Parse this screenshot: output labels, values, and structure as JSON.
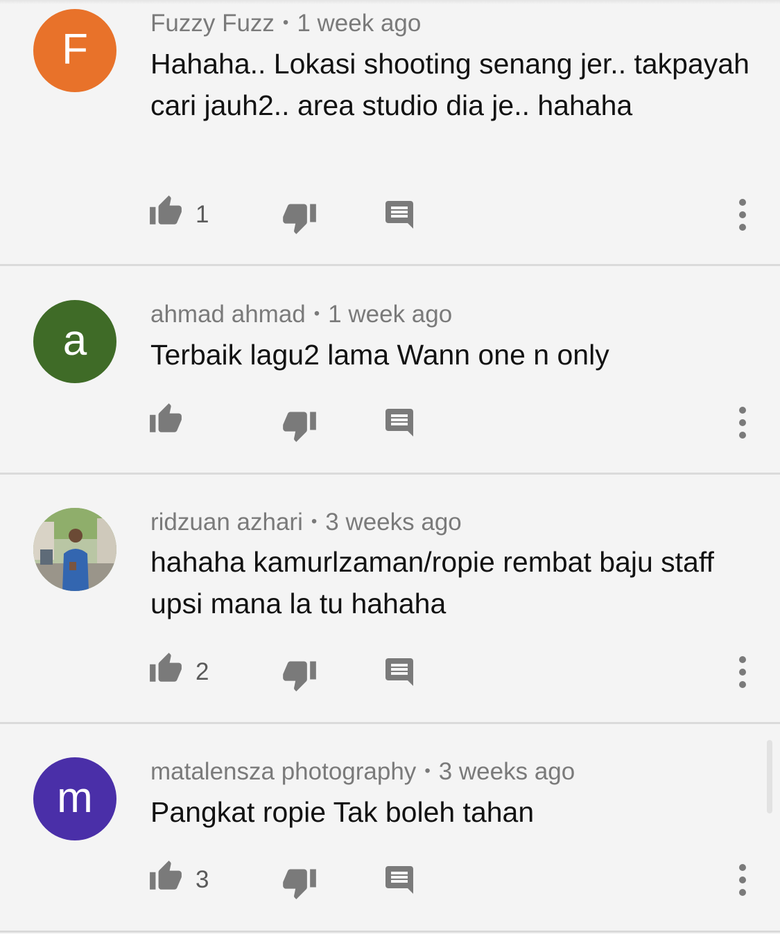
{
  "comments": [
    {
      "author": "Fuzzy Fuzz",
      "separator": "•",
      "time": "1 week ago",
      "avatar_letter": "F",
      "avatar_color": "#e8722a",
      "text": "Hahaha.. Lokasi shooting senang jer.. takpayah cari jauh2.. area studio dia je.. hahaha",
      "likes": "1"
    },
    {
      "author": "ahmad ahmad",
      "separator": "•",
      "time": "1 week ago",
      "avatar_letter": "a",
      "avatar_color": "#3f6b27",
      "text": "Terbaik lagu2 lama Wann one n only",
      "likes": ""
    },
    {
      "author": "ridzuan azhari",
      "separator": "•",
      "time": "3 weeks ago",
      "avatar_letter": "",
      "avatar_color": "#7f8f6a",
      "text": "hahaha kamurlzaman/ropie rembat baju staff upsi mana la tu hahaha",
      "likes": "2"
    },
    {
      "author": "matalensza photography",
      "separator": "•",
      "time": "3 weeks ago",
      "avatar_letter": "m",
      "avatar_color": "#4a2fa8",
      "text": "Pangkat ropie Tak boleh tahan",
      "likes": "3"
    }
  ],
  "icons": {
    "like": "thumb-up-icon",
    "dislike": "thumb-down-icon",
    "reply": "reply-comment-icon",
    "more": "more-vertical-icon"
  },
  "colors": {
    "background": "#f4f4f4",
    "icon": "#7a7a7a",
    "meta_text": "#7a7a7a",
    "body_text": "#121212",
    "divider": "#dadada"
  }
}
